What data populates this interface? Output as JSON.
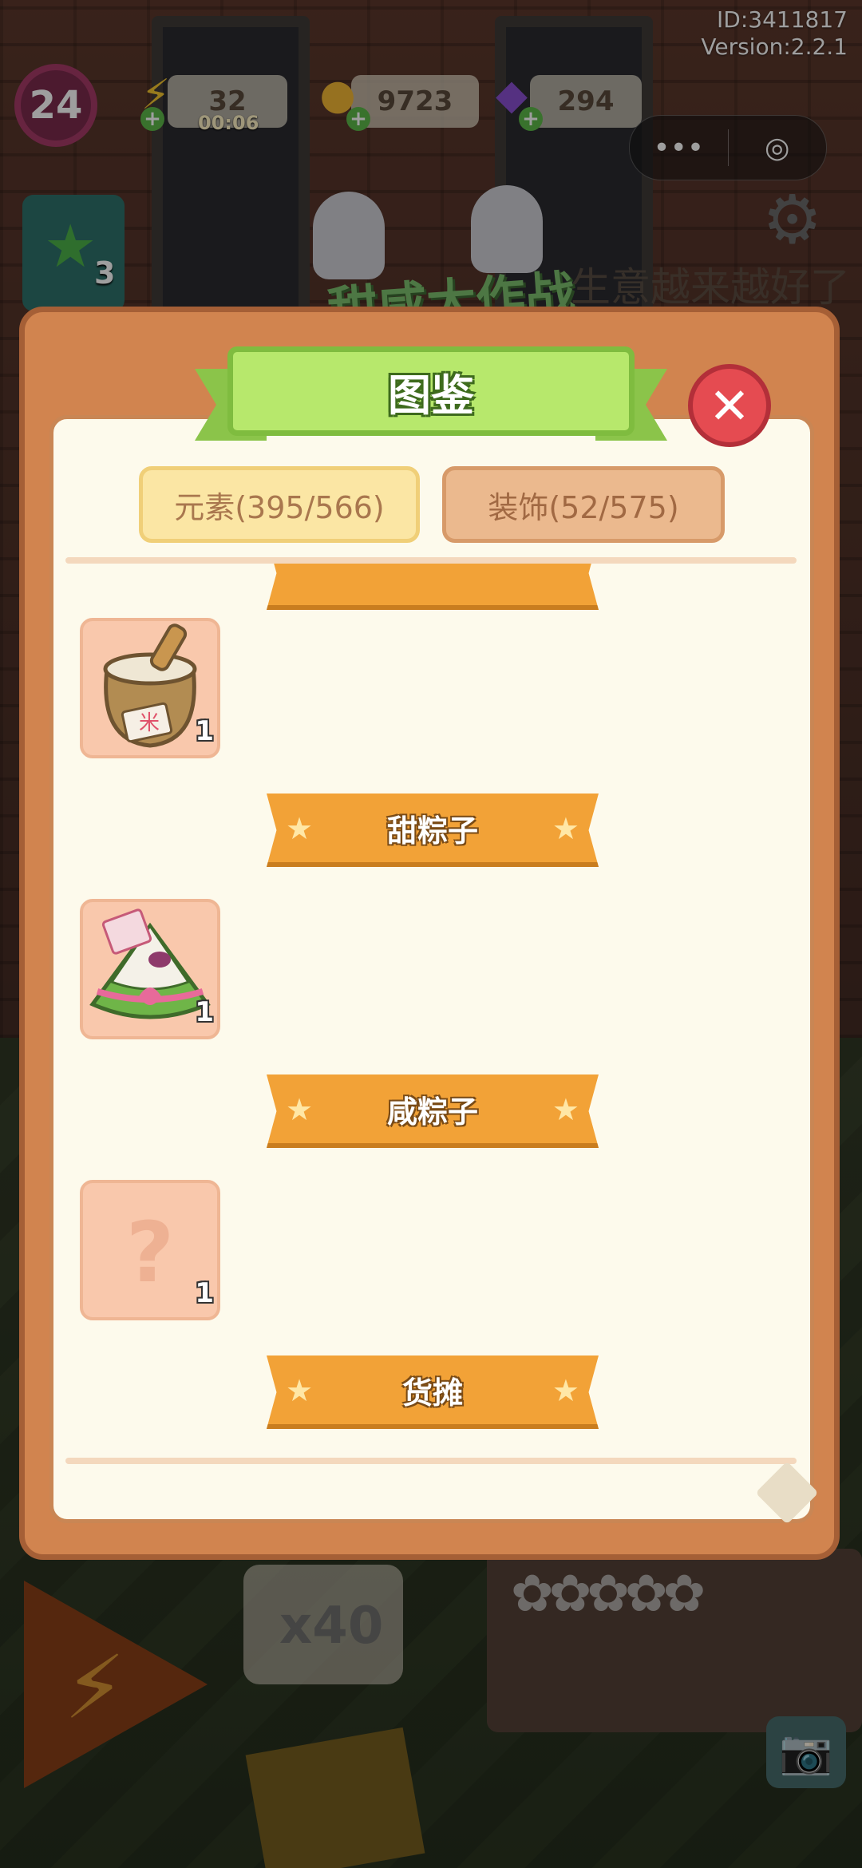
{
  "hud": {
    "user_id": "ID:3411817",
    "version": "Version:2.2.1",
    "level": "24",
    "energy": "32",
    "energy_timer": "00:06",
    "coins": "9723",
    "gems": "294",
    "quest_count": "3",
    "menu_icon": "more-dots-icon",
    "exit_icon": "target-icon"
  },
  "banner": {
    "game_logo": "甜咸大作战",
    "scroll_message": "生意越来越好了"
  },
  "bottom": {
    "multiplier": "x40"
  },
  "modal": {
    "title": "图鉴",
    "tabs": [
      {
        "label": "元素(395/566)",
        "active": true
      },
      {
        "label": "装饰(52/575)",
        "active": false
      }
    ],
    "entries": [
      {
        "ribbon": "",
        "item": "rice-sack-icon",
        "count": "1"
      },
      {
        "ribbon": "甜粽子",
        "item": "sweet-zongzi-icon",
        "count": "1"
      },
      {
        "ribbon": "咸粽子",
        "item": "unknown-item-icon",
        "count": "1"
      },
      {
        "ribbon": "货摊"
      }
    ],
    "rice_bag_label": "米"
  },
  "colors": {
    "modal_frame": "#d1844f",
    "title_banner": "#b7e86c",
    "close_button": "#e54b51",
    "ribbon": "#f2a237",
    "card": "#f9c8ac"
  }
}
